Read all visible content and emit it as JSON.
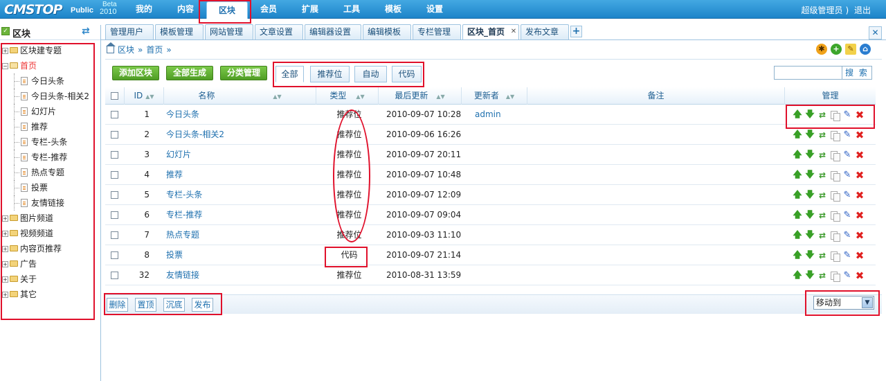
{
  "header": {
    "logo_brand": "CMSTOP",
    "logo_edition": "Public",
    "logo_beta": "Beta",
    "logo_year": "2010",
    "nav": [
      "我的",
      "内容",
      "区块",
      "会员",
      "扩展",
      "工具",
      "模板",
      "设置"
    ],
    "active_nav": "区块",
    "user": "超级管理员",
    "user_suffix": ")",
    "logout": "退出"
  },
  "sidebar": {
    "title": "区块",
    "tree": [
      {
        "label": "区块建专题",
        "type": "folder",
        "expanded": false
      },
      {
        "label": "首页",
        "type": "folder",
        "expanded": true,
        "selected": true
      },
      {
        "label": "今日头条",
        "type": "leaf"
      },
      {
        "label": "今日头条-相关2",
        "type": "leaf"
      },
      {
        "label": "幻灯片",
        "type": "leaf"
      },
      {
        "label": "推荐",
        "type": "leaf"
      },
      {
        "label": "专栏-头条",
        "type": "leaf"
      },
      {
        "label": "专栏-推荐",
        "type": "leaf"
      },
      {
        "label": "热点专题",
        "type": "leaf"
      },
      {
        "label": "投票",
        "type": "leaf"
      },
      {
        "label": "友情链接",
        "type": "leaf"
      },
      {
        "label": "图片频道",
        "type": "folder",
        "expanded": false
      },
      {
        "label": "视频频道",
        "type": "folder",
        "expanded": false
      },
      {
        "label": "内容页推荐",
        "type": "folder",
        "expanded": false
      },
      {
        "label": "广告",
        "type": "folder",
        "expanded": false
      },
      {
        "label": "关于",
        "type": "folder",
        "expanded": false
      },
      {
        "label": "其它",
        "type": "folder",
        "expanded": false
      }
    ]
  },
  "tabs": [
    "管理用户",
    "模板管理",
    "网站管理",
    "文章设置",
    "编辑器设置",
    "编辑模板",
    "专栏管理",
    "区块_首页",
    "发布文章"
  ],
  "active_tab": "区块_首页",
  "breadcrumb": [
    "区块",
    "»",
    "首页",
    "»"
  ],
  "toolbar": {
    "buttons": [
      "添加区块",
      "全部生成",
      "分类管理"
    ],
    "filters": [
      "全部",
      "推荐位",
      "自动",
      "代码"
    ],
    "active_filter": "全部",
    "search_placeholder": "",
    "search_label": "搜 索"
  },
  "table": {
    "columns": [
      "ID",
      "名称",
      "类型",
      "最后更新",
      "更新者",
      "备注",
      "管理"
    ],
    "rows": [
      {
        "id": "1",
        "name": "今日头条",
        "type": "推荐位",
        "updated": "2010-09-07 10:28",
        "updater": "admin",
        "note": ""
      },
      {
        "id": "2",
        "name": "今日头条-相关2",
        "type": "推荐位",
        "updated": "2010-09-06 16:26",
        "updater": "",
        "note": ""
      },
      {
        "id": "3",
        "name": "幻灯片",
        "type": "推荐位",
        "updated": "2010-09-07 20:11",
        "updater": "",
        "note": ""
      },
      {
        "id": "4",
        "name": "推荐",
        "type": "推荐位",
        "updated": "2010-09-07 10:48",
        "updater": "",
        "note": ""
      },
      {
        "id": "5",
        "name": "专栏-头条",
        "type": "推荐位",
        "updated": "2010-09-07 12:09",
        "updater": "",
        "note": ""
      },
      {
        "id": "6",
        "name": "专栏-推荐",
        "type": "推荐位",
        "updated": "2010-09-07 09:04",
        "updater": "",
        "note": ""
      },
      {
        "id": "7",
        "name": "热点专题",
        "type": "推荐位",
        "updated": "2010-09-03 11:10",
        "updater": "",
        "note": ""
      },
      {
        "id": "8",
        "name": "投票",
        "type": "代码",
        "updated": "2010-09-07 21:14",
        "updater": "",
        "note": ""
      },
      {
        "id": "32",
        "name": "友情链接",
        "type": "推荐位",
        "updated": "2010-08-31 13:59",
        "updater": "",
        "note": ""
      }
    ],
    "row_actions": [
      "move-up",
      "move-down",
      "refresh",
      "copy",
      "edit",
      "delete"
    ]
  },
  "footer": {
    "buttons": [
      "删除",
      "置顶",
      "沉底",
      "发布"
    ],
    "move_to": "移动到"
  },
  "colors": {
    "accent": "#1d84c9",
    "annotation": "#e0102b",
    "button_green": "#4f9d24"
  }
}
